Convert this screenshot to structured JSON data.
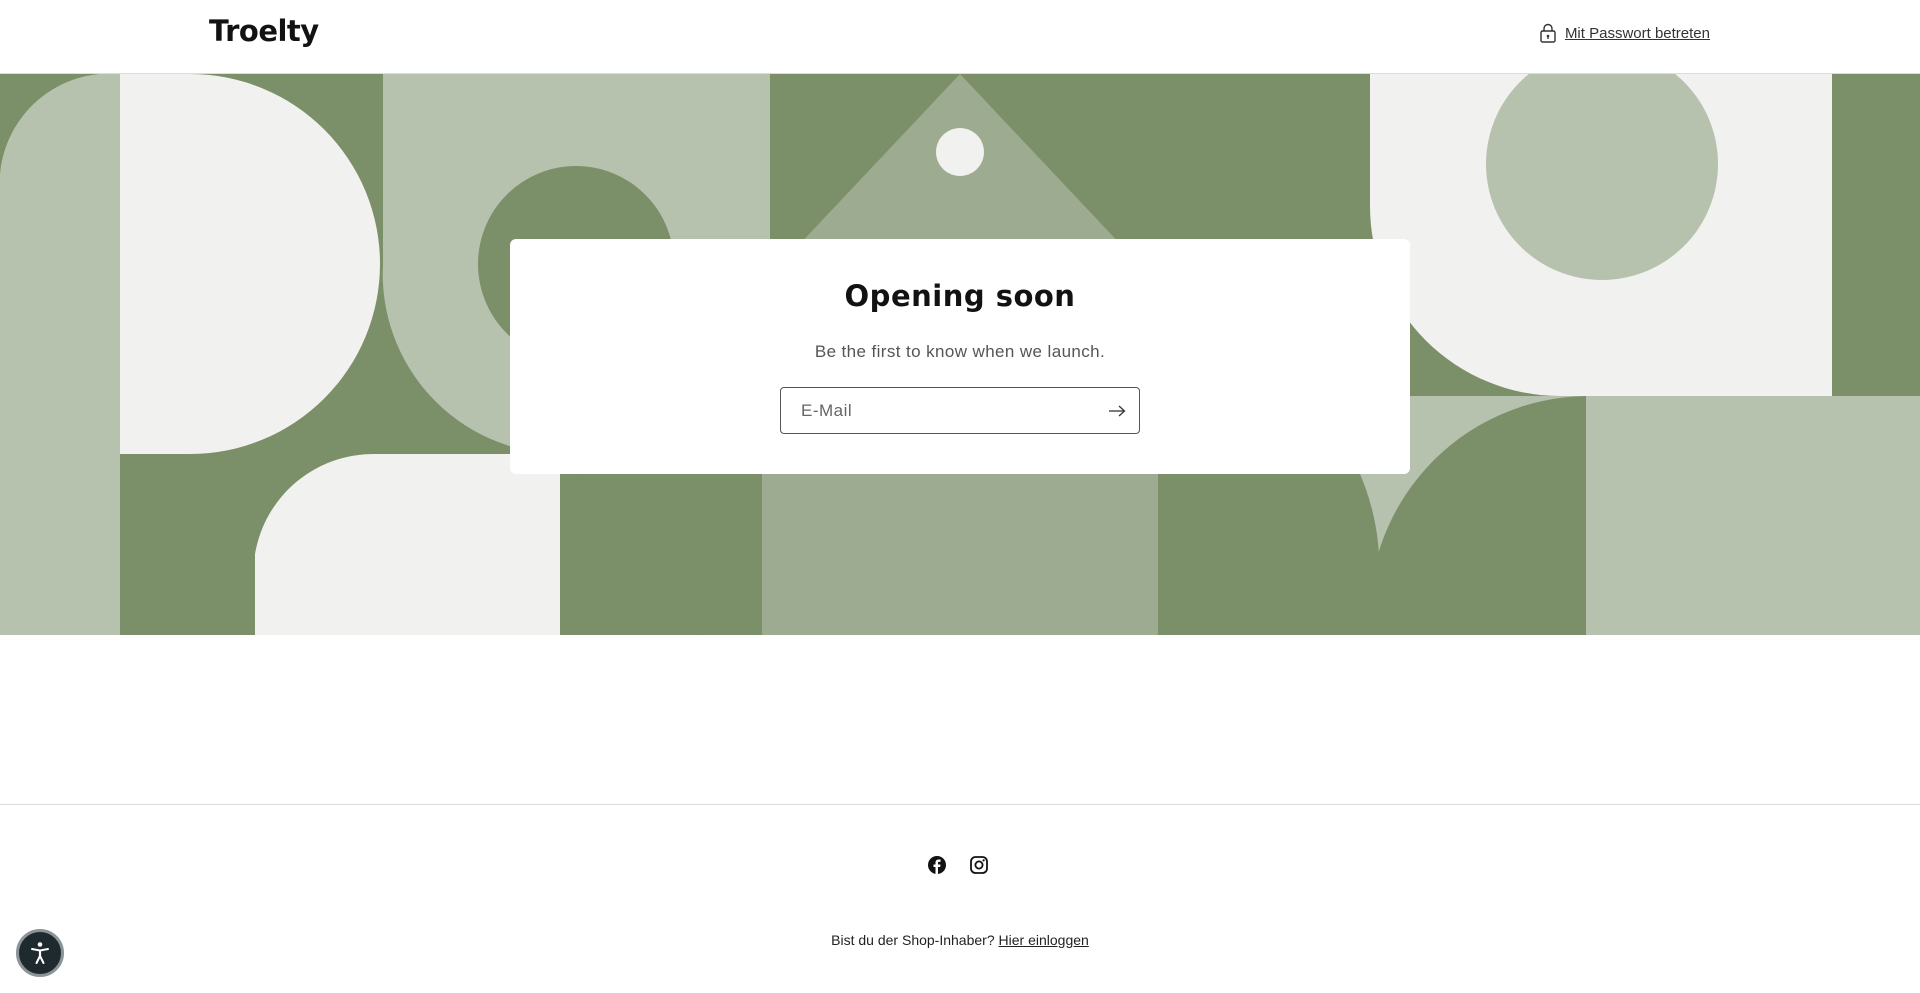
{
  "header": {
    "logo_text": "Troelty",
    "password_link": "Mit Passwort betreten"
  },
  "hero": {
    "colors": {
      "dark_green": "#7b8f68",
      "light_sage": "#b7c2ae",
      "mid_sage": "#9dab90",
      "off_white": "#f1f1ef"
    }
  },
  "card": {
    "title": "Opening soon",
    "subtitle": "Be the first to know when we launch.",
    "email_placeholder": "E-Mail"
  },
  "footer": {
    "social": [
      "facebook-icon",
      "instagram-icon"
    ],
    "owner_question": "Bist du der Shop-Inhaber?",
    "owner_login_link": "Hier einloggen"
  },
  "accessibility": {
    "icon": "accessibility-icon"
  }
}
